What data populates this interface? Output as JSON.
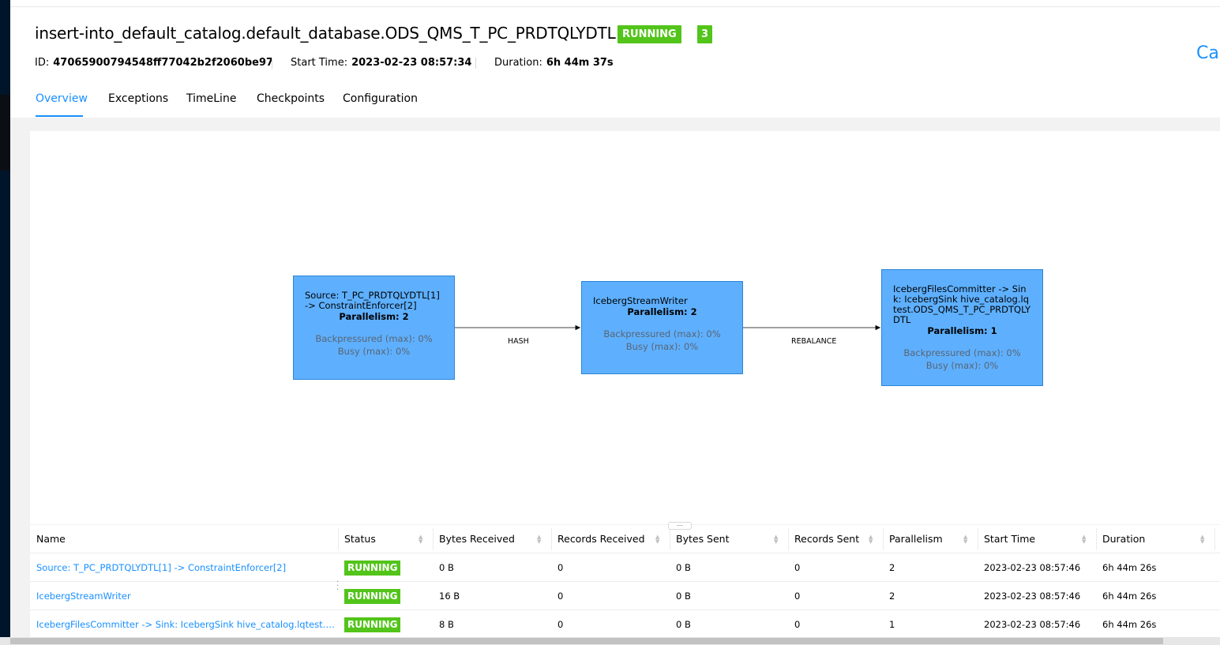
{
  "job": {
    "title": "insert-into_default_catalog.default_database.ODS_QMS_T_PC_PRDTQLYDTL",
    "status": "RUNNING",
    "task_count": "3",
    "id_label": "ID:",
    "id": "47065900794548ff77042b2f2060be97",
    "start_label": "Start Time:",
    "start_time": "2023-02-23 08:57:34",
    "duration_label": "Duration:",
    "duration": "6h 44m 37s",
    "cancel_label": "Car"
  },
  "tabs": [
    {
      "label": "Overview",
      "active": true
    },
    {
      "label": "Exceptions",
      "active": false
    },
    {
      "label": "TimeLine",
      "active": false
    },
    {
      "label": "Checkpoints",
      "active": false
    },
    {
      "label": "Configuration",
      "active": false
    }
  ],
  "graph": {
    "nodes": [
      {
        "name": "Source: T_PC_PRDTQLYDTL[1] -> ConstraintEnforcer[2]",
        "parallelism": "Parallelism: 2",
        "backpressured": "Backpressured (max): 0%",
        "busy": "Busy (max): 0%"
      },
      {
        "name": "IcebergStreamWriter",
        "parallelism": "Parallelism: 2",
        "backpressured": "Backpressured (max): 0%",
        "busy": "Busy (max): 0%"
      },
      {
        "name": "IcebergFilesCommitter -> Sink: IcebergSink hive_catalog.lqtest.ODS_QMS_T_PC_PRDTQLYDTL",
        "parallelism": "Parallelism: 1",
        "backpressured": "Backpressured (max): 0%",
        "busy": "Busy (max): 0%"
      }
    ],
    "edges": [
      {
        "label": "HASH"
      },
      {
        "label": "REBALANCE"
      }
    ],
    "node_color": "#5eb0ff"
  },
  "table": {
    "splitter": "...",
    "columns": [
      "Name",
      "Status",
      "Bytes Received",
      "Records Received",
      "Bytes Sent",
      "Records Sent",
      "Parallelism",
      "Start Time",
      "Duration"
    ],
    "rows": [
      {
        "name": "Source: T_PC_PRDTQLYDTL[1] -> ConstraintEnforcer[2]",
        "status": "RUNNING",
        "bytes_received": "0 B",
        "records_received": "0",
        "bytes_sent": "0 B",
        "records_sent": "0",
        "parallelism": "2",
        "start_time": "2023-02-23 08:57:46",
        "duration": "6h 44m 26s"
      },
      {
        "name": "IcebergStreamWriter",
        "status": "RUNNING",
        "bytes_received": "16 B",
        "records_received": "0",
        "bytes_sent": "0 B",
        "records_sent": "0",
        "parallelism": "2",
        "start_time": "2023-02-23 08:57:46",
        "duration": "6h 44m 26s"
      },
      {
        "name": "IcebergFilesCommitter -> Sink: IcebergSink hive_catalog.lqtest.ODS_Q...",
        "status": "RUNNING",
        "bytes_received": "8 B",
        "records_received": "0",
        "bytes_sent": "0 B",
        "records_sent": "0",
        "parallelism": "1",
        "start_time": "2023-02-23 08:57:46",
        "duration": "6h 44m 26s"
      }
    ]
  },
  "colors": {
    "accent": "#1890ff",
    "running": "#52c41a",
    "sidebar": "#001529"
  }
}
